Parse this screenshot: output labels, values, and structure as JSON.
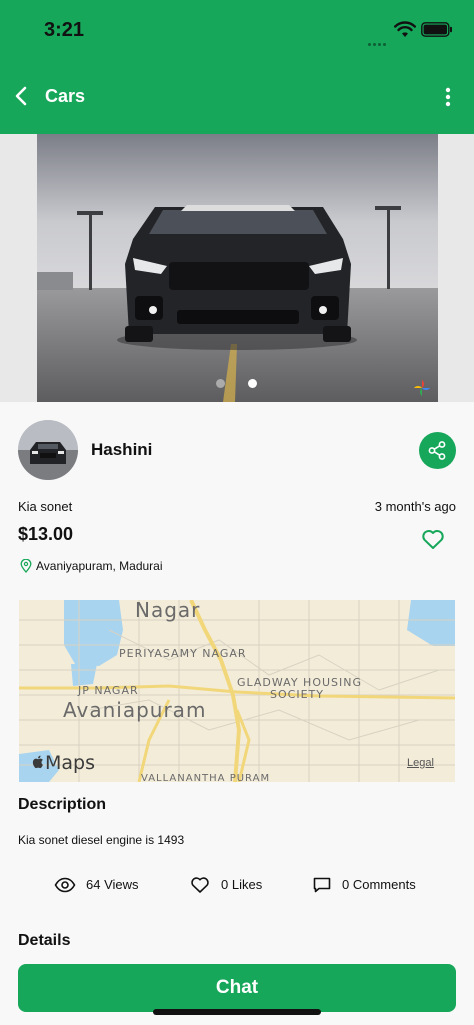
{
  "status_bar": {
    "time": "3:21"
  },
  "app_bar": {
    "title": "Cars"
  },
  "listing": {
    "seller_name": "Hashini",
    "product_title": "Kia sonet",
    "posted_time": "3 month's ago",
    "price": "$13.00",
    "location": "Avaniyapuram, Madurai"
  },
  "map": {
    "labels": {
      "nagar": "Nagar",
      "periyasamy": "PERIYASAMY NAGAR",
      "jp_nagar": "JP NAGAR",
      "gladway_1": "GLADWAY HOUSING",
      "gladway_2": "SOCIETY",
      "avaniapuram": "Avaniapuram",
      "vallanantha": "VALLANANTHA PURAM"
    },
    "logo_text": "Maps",
    "legal_label": "Legal"
  },
  "description": {
    "heading": "Description",
    "text": "Kia sonet diesel engine is 1493"
  },
  "stats": {
    "views": "64 Views",
    "likes": "0 Likes",
    "comments": "0 Comments"
  },
  "details": {
    "heading": "Details"
  },
  "chat_button": {
    "label": "Chat"
  },
  "colors": {
    "brand_green": "#17a75a"
  },
  "icons": [
    "back-icon",
    "more-icon",
    "share-icon",
    "heart-icon",
    "location-pin-icon",
    "eye-icon",
    "comment-icon",
    "wifi-icon",
    "battery-icon"
  ]
}
